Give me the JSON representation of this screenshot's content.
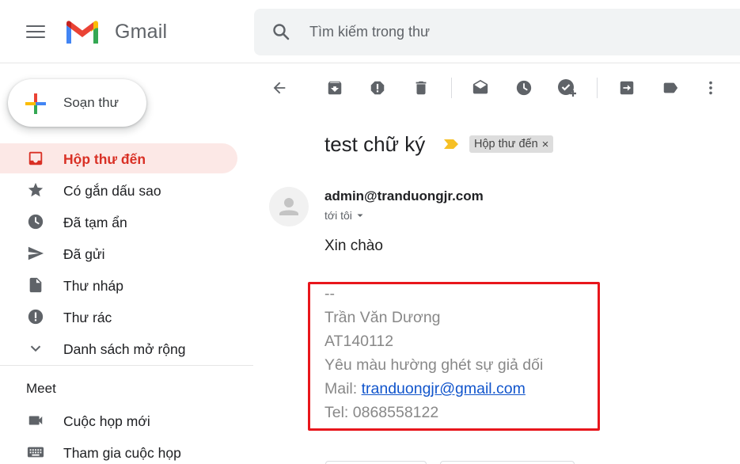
{
  "app": {
    "brand": "Gmail"
  },
  "search": {
    "placeholder": "Tìm kiếm trong thư"
  },
  "sidebar": {
    "compose_label": "Soạn thư",
    "items": [
      {
        "label": "Hộp thư đến",
        "icon": "inbox-icon",
        "active": true
      },
      {
        "label": "Có gắn dấu sao",
        "icon": "star-icon"
      },
      {
        "label": "Đã tạm ẩn",
        "icon": "clock-icon"
      },
      {
        "label": "Đã gửi",
        "icon": "send-icon"
      },
      {
        "label": "Thư nháp",
        "icon": "draft-icon"
      },
      {
        "label": "Thư rác",
        "icon": "spam-icon"
      },
      {
        "label": "Danh sách mở rộng",
        "icon": "chevron-down-icon"
      }
    ],
    "meet": {
      "title": "Meet",
      "items": [
        {
          "label": "Cuộc họp mới",
          "icon": "video-camera-icon"
        },
        {
          "label": "Tham gia cuộc họp",
          "icon": "keyboard-icon"
        }
      ]
    }
  },
  "toolbar": {
    "icons": [
      "back-arrow-icon",
      "archive-icon",
      "report-spam-icon",
      "delete-icon",
      "mark-unread-icon",
      "snooze-icon",
      "add-to-tasks-icon",
      "move-to-icon",
      "label-icon",
      "more-vert-icon"
    ]
  },
  "message": {
    "subject": "test chữ ký",
    "label_chip": "Hộp thư đến",
    "label_chip_close": "×",
    "sender": "admin@tranduongjr.com",
    "to_line": "tới tôi",
    "body": "Xin chào",
    "signature": {
      "separator": "--",
      "name": "Trần Văn Dương",
      "code": "AT140112",
      "motto": "Yêu màu hường ghét sự giả dối",
      "mail_prefix": "Mail: ",
      "mail": "tranduongjr@gmail.com",
      "tel": "Tel: 0868558122"
    }
  },
  "colors": {
    "active_red": "#d93025",
    "active_bg": "#fce8e6",
    "highlight_box": "#e8161c",
    "link": "#1155cc",
    "signature_gray": "#888888"
  }
}
